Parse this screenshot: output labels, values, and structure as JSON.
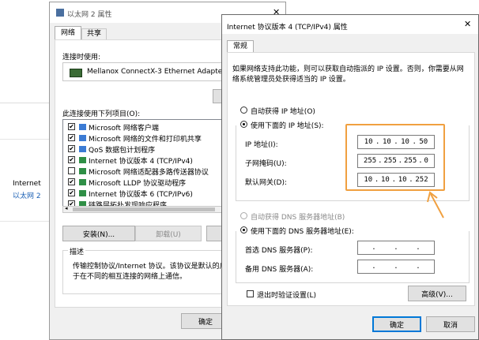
{
  "background_panel": {
    "network_label": "Internet",
    "adapter_link": "以太网 2"
  },
  "props_window": {
    "title": "以太网 2 属性",
    "tabs": [
      "网络",
      "共享"
    ],
    "connect_using_label": "连接时使用:",
    "adapter_name": "Mellanox ConnectX-3 Ethernet Adapter",
    "items_label": "此连接使用下列项目(O):",
    "items": [
      {
        "label": "Microsoft 网络客户端",
        "checked": true
      },
      {
        "label": "Microsoft 网络的文件和打印机共享",
        "checked": true
      },
      {
        "label": "QoS 数据包计划程序",
        "checked": true
      },
      {
        "label": "Internet 协议版本 4 (TCP/IPv4)",
        "checked": true
      },
      {
        "label": "Microsoft 网络适配器多路传送器协议",
        "checked": false
      },
      {
        "label": "Microsoft LLDP 协议驱动程序",
        "checked": true
      },
      {
        "label": "Internet 协议版本 6 (TCP/IPv6)",
        "checked": true
      },
      {
        "label": "链路层拓扑发现响应程序",
        "checked": true
      }
    ],
    "install_button": "安装(N)...",
    "uninstall_button": "卸载(U)",
    "description_title": "描述",
    "description_text_1": "传输控制协议/Internet 协议。该协议是默认的广域",
    "description_text_2": "于在不同的相互连接的网络上通信。",
    "ok_button": "确定"
  },
  "ipv4_dialog": {
    "title": "Internet 协议版本 4 (TCP/IPv4) 属性",
    "tab": "常规",
    "intro_1": "如果网络支持此功能，则可以获取自动指派的 IP 设置。否则，你需要从网",
    "intro_2": "络系统管理员处获得适当的 IP 设置。",
    "auto_ip": "自动获得 IP 地址(O)",
    "manual_ip": "使用下面的 IP 地址(S):",
    "ip_label": "IP 地址(I):",
    "subnet_label": "子网掩码(U):",
    "gateway_label": "默认网关(D):",
    "ip_value": [
      "10",
      "10",
      "10",
      "50"
    ],
    "subnet_value": [
      "255",
      "255",
      "255",
      "0"
    ],
    "gateway_value": [
      "10",
      "10",
      "10",
      "252"
    ],
    "auto_dns": "自动获得 DNS 服务器地址(B)",
    "manual_dns": "使用下面的 DNS 服务器地址(E):",
    "pref_dns_label": "首选 DNS 服务器(P):",
    "alt_dns_label": "备用 DNS 服务器(A):",
    "validate_label": "退出时验证设置(L)",
    "advanced_button": "高级(V)...",
    "ok_button": "确定",
    "cancel_button": "取消",
    "close_glyph": "✕"
  },
  "colors": {
    "highlight_box": "#f0a040",
    "arrow": "#f0a040",
    "link": "#1a5fb4",
    "accent": "#0078d7"
  }
}
